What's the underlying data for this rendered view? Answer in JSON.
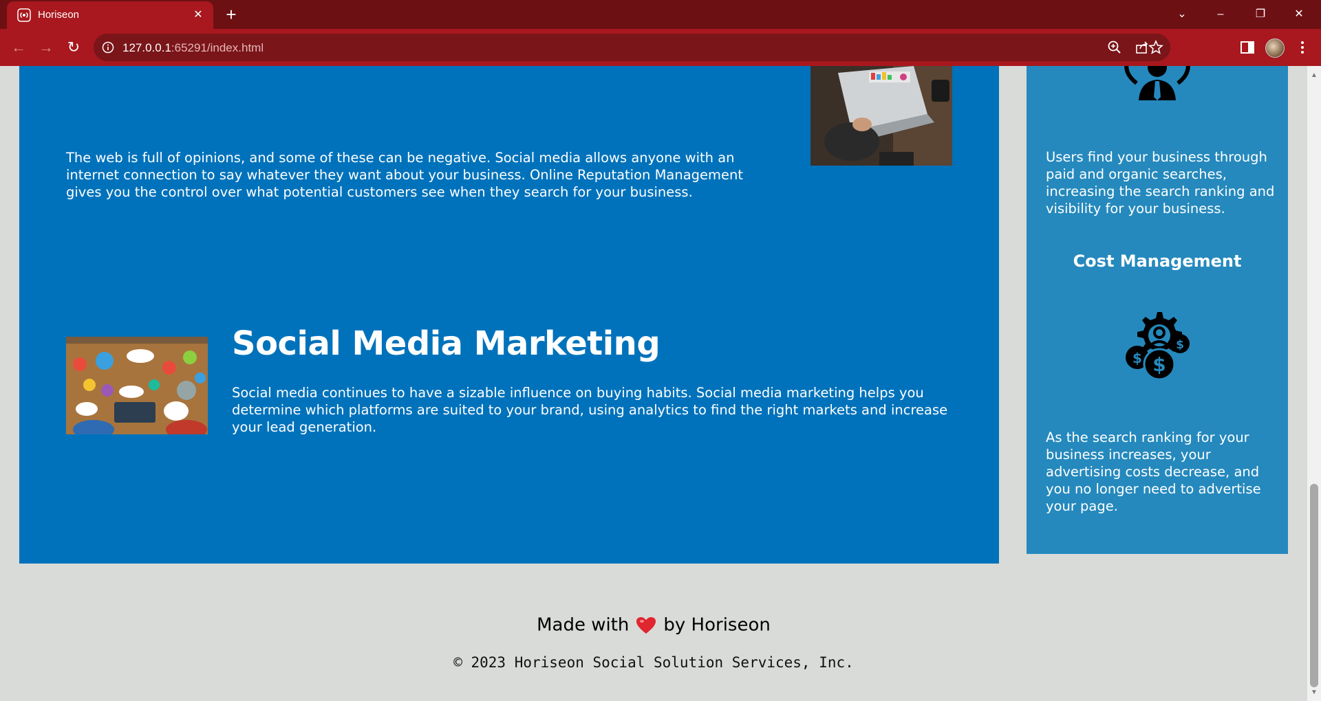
{
  "browser": {
    "tab_title": "Horiseon",
    "url_host": "127.0.0.1",
    "url_rest": ":65291/index.html",
    "accent_color": "#a8181e",
    "tabbar_color": "#6d1014"
  },
  "cards": {
    "reputation": {
      "text": "The web is full of opinions, and some of these can be negative. Social media allows anyone with an internet connection to say whatever they want about your business. Online Reputation Management gives you the control over what potential customers see when they search for your business."
    },
    "social_media": {
      "title": "Social Media Marketing",
      "text": "Social media continues to have a sizable influence on buying habits. Social media marketing helps you determine which platforms are suited to your brand, using analytics to find the right markets and increase your lead generation."
    }
  },
  "sidebar": {
    "lead_text": "Users find your business through paid and organic searches, increasing the search ranking and visibility for your business.",
    "cost_heading": "Cost Management",
    "cost_text": "As the search ranking for your business increases, your advertising costs decrease, and you no longer need to advertise your page."
  },
  "footer": {
    "made_with": "Made with",
    "by": "by Horiseon",
    "copyright": "© 2023 Horiseon Social Solution Services, Inc."
  },
  "colors": {
    "card_blue": "#0072bb",
    "sidebar_blue": "#2589bd",
    "page_bg": "#d9dbd8",
    "heart": "#e0262e"
  },
  "icons": [
    "radio-favicon",
    "info-icon",
    "zoom-icon",
    "share-icon",
    "star-icon",
    "sidebar-icon",
    "menu-icon",
    "lightbulb-person-icon",
    "cost-gear-icon",
    "heart-icon"
  ]
}
